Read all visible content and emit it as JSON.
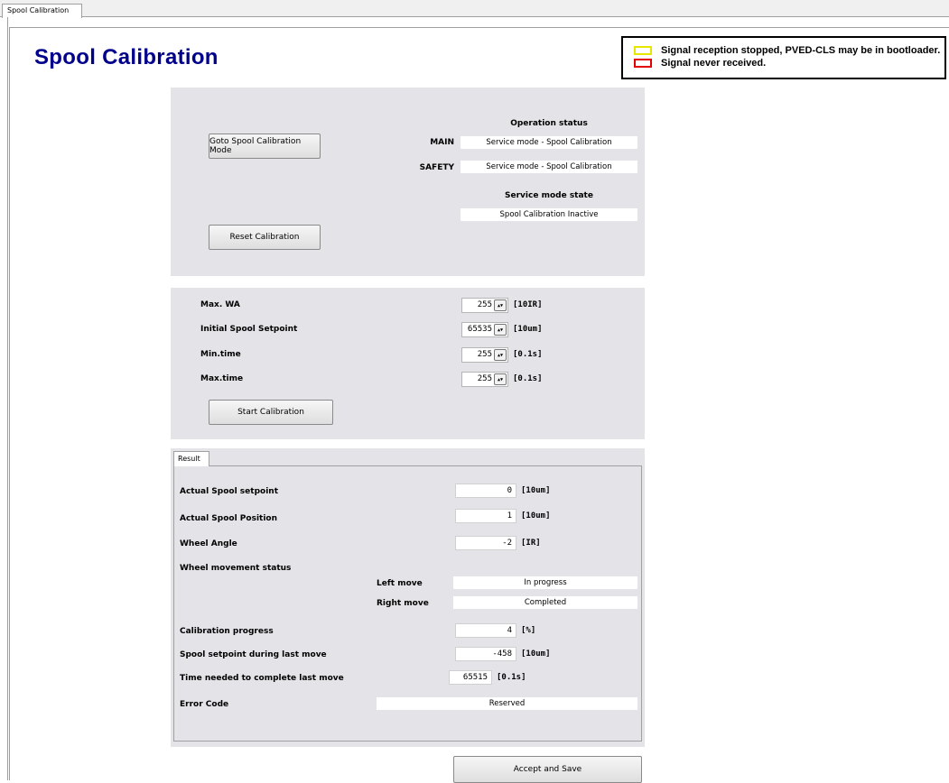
{
  "tab": {
    "label": "Spool Calibration"
  },
  "title": "Spool Calibration",
  "legend": {
    "items": [
      {
        "color": "#e6e600",
        "text": "Signal reception stopped, PVED-CLS may be in bootloader."
      },
      {
        "color": "#e00000",
        "text": "Signal never received."
      }
    ]
  },
  "mode_panel": {
    "goto_button": "Goto Spool Calibration Mode",
    "reset_button": "Reset Calibration",
    "operation_status_header": "Operation status",
    "main_label": "MAIN",
    "main_value": "Service mode - Spool Calibration",
    "safety_label": "SAFETY",
    "safety_value": "Service mode - Spool Calibration",
    "service_state_header": "Service mode state",
    "service_state_value": "Spool Calibration Inactive"
  },
  "params_panel": {
    "max_wa": {
      "label": "Max. WA",
      "value": "255",
      "unit": "[10IR]"
    },
    "initial_setpoint": {
      "label": "Initial Spool Setpoint",
      "value": "65535",
      "unit": "[10um]"
    },
    "min_time": {
      "label": "Min.time",
      "value": "255",
      "unit": "[0.1s]"
    },
    "max_time": {
      "label": "Max.time",
      "value": "255",
      "unit": "[0.1s]"
    },
    "start_button": "Start Calibration"
  },
  "result": {
    "tab_label": "Result",
    "actual_setpoint": {
      "label": "Actual Spool setpoint",
      "value": "0",
      "unit": "[10um]"
    },
    "actual_position": {
      "label": "Actual Spool Position",
      "value": "1",
      "unit": "[10um]"
    },
    "wheel_angle": {
      "label": "Wheel Angle",
      "value": "-2",
      "unit": "[IR]"
    },
    "movement_status_label": "Wheel movement status",
    "left_move": {
      "label": "Left move",
      "value": "In progress"
    },
    "right_move": {
      "label": "Right move",
      "value": "Completed"
    },
    "progress": {
      "label": "Calibration progress",
      "value": "4",
      "unit": "[%]"
    },
    "last_setpoint": {
      "label": "Spool setpoint during last move",
      "value": "-458",
      "unit": "[10um]"
    },
    "time_needed": {
      "label": "Time needed to complete last move",
      "value": "65515",
      "unit": "[0.1s]"
    },
    "error_code": {
      "label": "Error Code",
      "value": "Reserved"
    }
  },
  "accept_button": "Accept and Save"
}
